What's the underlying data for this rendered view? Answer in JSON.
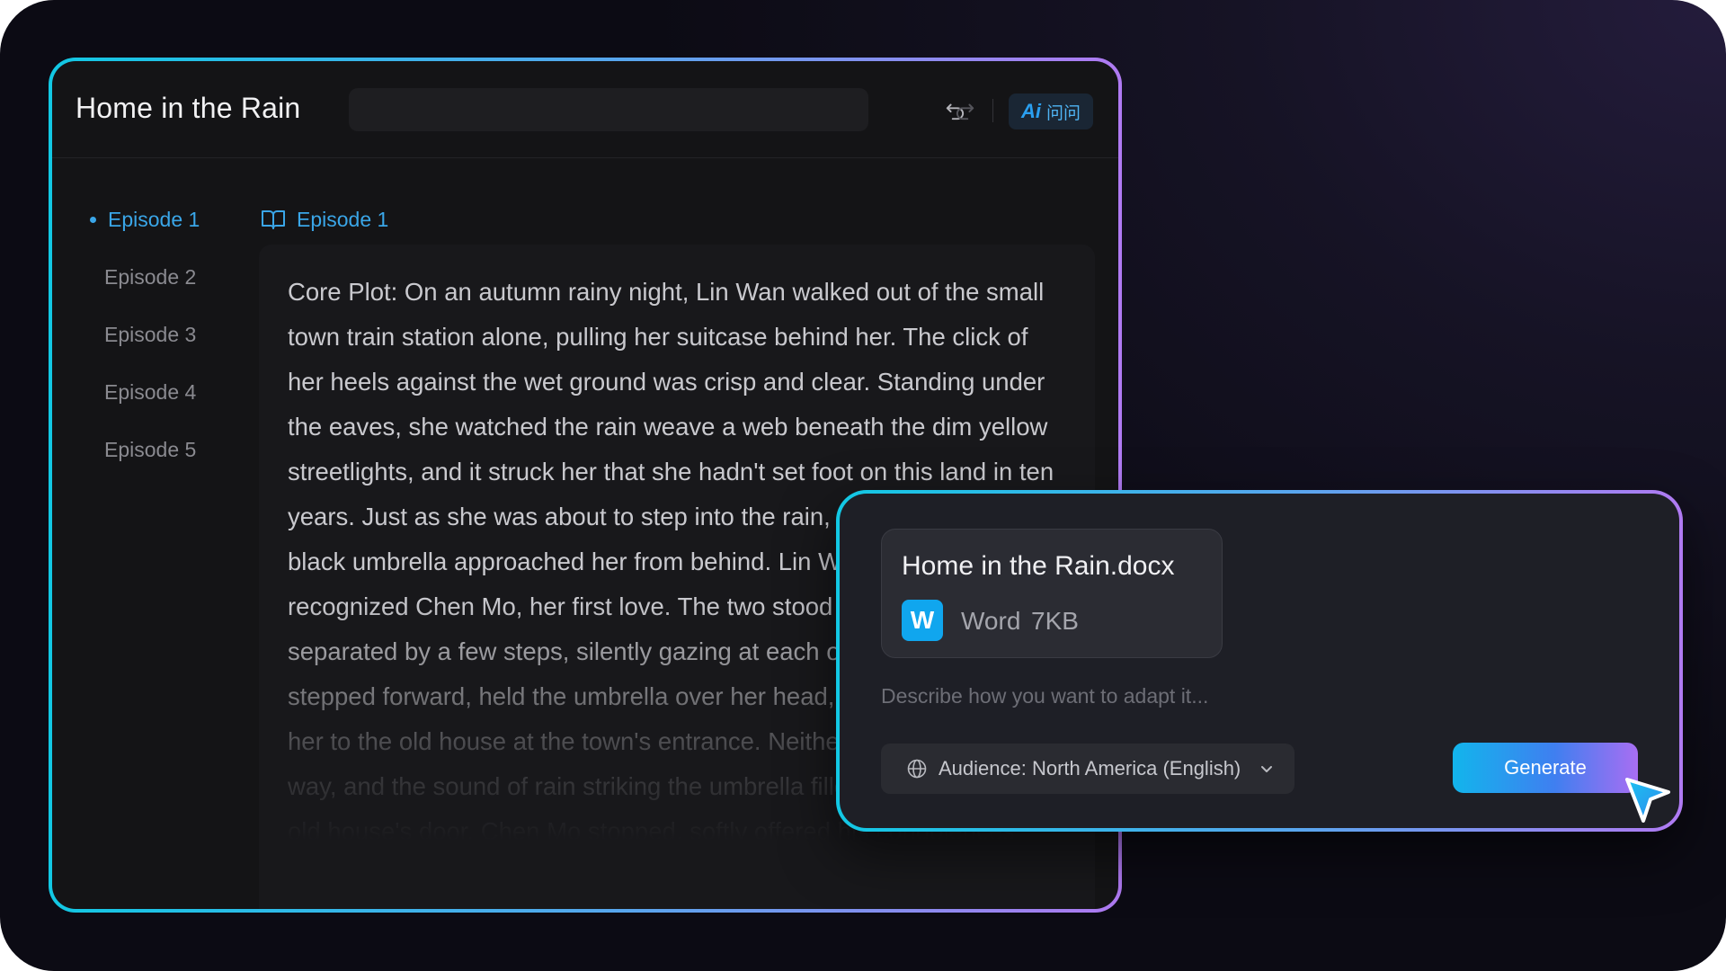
{
  "editor": {
    "title": "Home in the Rain",
    "title_input_value": "",
    "ai_button": {
      "logo": "Ai",
      "label": "问问"
    },
    "episodes": [
      {
        "label": "Episode 1",
        "active": true
      },
      {
        "label": "Episode 2",
        "active": false
      },
      {
        "label": "Episode 3",
        "active": false
      },
      {
        "label": "Episode 4",
        "active": false
      },
      {
        "label": "Episode 5",
        "active": false
      }
    ],
    "content_heading": "Episode 1",
    "content_text": "Core Plot: On an autumn rainy night, Lin Wan walked out of the small town train station alone, pulling her suitcase behind her. The click of her heels against the wet ground was crisp and clear. Standing under the eaves, she watched the rain weave a web beneath the dim yellow streetlights, and it struck her that she hadn't set foot on this land in ten years. Just as she was about to step into the rain, a tall man holding a black umbrella approached her from behind. Lin Wan turned and recognized Chen Mo, her first love. The two stood in the rain, separated by a few steps, silently gazing at each other. Chen Mo stepped forward, held the umbrella over her head, and offered to take her to the old house at the town's entrance. Neither spoke the whole way, and the sound of rain striking the umbrella filled the silence. At the old house's door, Chen Mo stopped, softly offered his condolences"
  },
  "panel": {
    "file": {
      "name": "Home in the Rain.docx",
      "icon_letter": "W",
      "type": "Word",
      "size": "7KB"
    },
    "input_placeholder": "Describe how you want to adapt it...",
    "audience_label": "Audience: North America (English)",
    "generate_label": "Generate"
  },
  "colors": {
    "accent": "#3aa6e8",
    "frame_gradient": [
      "#12c8e4",
      "#5aa5ee",
      "#b07af2"
    ],
    "word_blue": "#10a6ee"
  },
  "icons": {
    "undo": "undo-icon",
    "redo": "redo-icon",
    "book": "book-icon",
    "globe": "globe-icon",
    "chevron": "chevron-down-icon",
    "cursor": "pointer-cursor-icon"
  }
}
